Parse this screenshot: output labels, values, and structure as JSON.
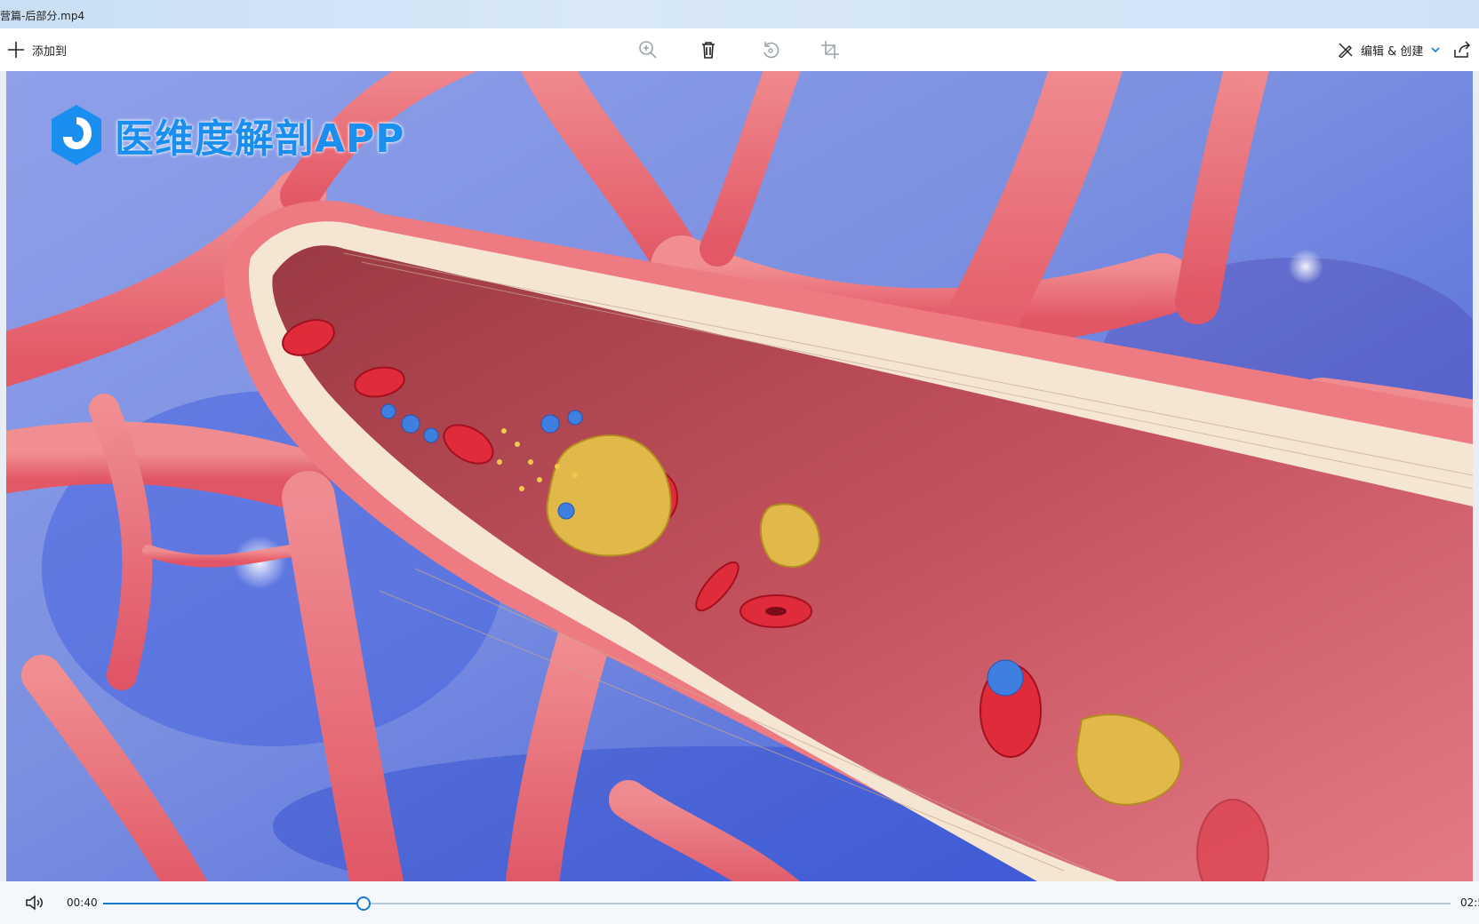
{
  "window": {
    "title": "营篇-后部分.mp4"
  },
  "toolbar": {
    "add_to_label": "添加到",
    "edit_create_label": "编辑 & 创建",
    "icons": [
      "plus-icon",
      "zoom-icon",
      "trash-icon",
      "rotate-icon",
      "crop-icon",
      "edit-create-icon",
      "chevron-down-icon",
      "share-icon"
    ]
  },
  "video": {
    "watermark_text": "医维度解剖APP"
  },
  "player": {
    "current_time": "00:40",
    "total_time": "02:5",
    "progress": 0.193
  },
  "colors": {
    "accent": "#1877d2",
    "watermark": "#1a8ff0"
  }
}
